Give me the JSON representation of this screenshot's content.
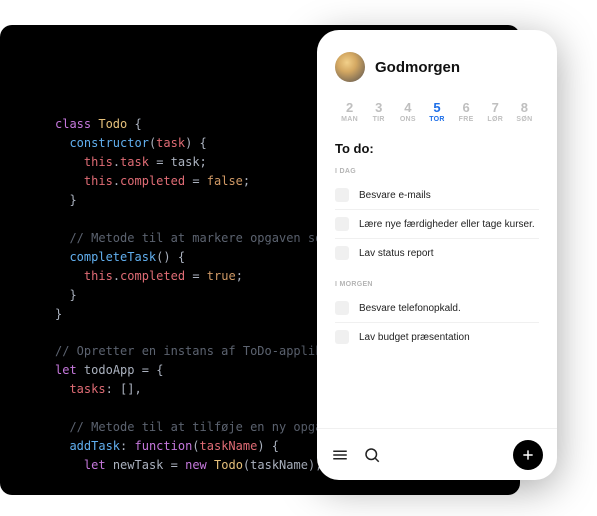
{
  "code": {
    "lines": [
      [
        [
          "kw",
          "class"
        ],
        [
          "plain",
          " "
        ],
        [
          "cls",
          "Todo"
        ],
        [
          "plain",
          " "
        ],
        [
          "punc",
          "{"
        ]
      ],
      [
        [
          "plain",
          "  "
        ],
        [
          "fn",
          "constructor"
        ],
        [
          "punc",
          "("
        ],
        [
          "param",
          "task"
        ],
        [
          "punc",
          ") {"
        ]
      ],
      [
        [
          "plain",
          "    "
        ],
        [
          "this",
          "this"
        ],
        [
          "punc",
          "."
        ],
        [
          "prop",
          "task"
        ],
        [
          "plain",
          " "
        ],
        [
          "punc",
          "="
        ],
        [
          "plain",
          " task"
        ],
        [
          "punc",
          ";"
        ]
      ],
      [
        [
          "plain",
          "    "
        ],
        [
          "this",
          "this"
        ],
        [
          "punc",
          "."
        ],
        [
          "prop",
          "completed"
        ],
        [
          "plain",
          " "
        ],
        [
          "punc",
          "="
        ],
        [
          "plain",
          " "
        ],
        [
          "bool",
          "false"
        ],
        [
          "punc",
          ";"
        ]
      ],
      [
        [
          "plain",
          "  "
        ],
        [
          "punc",
          "}"
        ]
      ],
      [
        [
          "plain",
          ""
        ]
      ],
      [
        [
          "plain",
          "  "
        ],
        [
          "cmt",
          "// Metode til at markere opgaven som"
        ]
      ],
      [
        [
          "plain",
          "  "
        ],
        [
          "fn",
          "completeTask"
        ],
        [
          "punc",
          "() {"
        ]
      ],
      [
        [
          "plain",
          "    "
        ],
        [
          "this",
          "this"
        ],
        [
          "punc",
          "."
        ],
        [
          "prop",
          "completed"
        ],
        [
          "plain",
          " "
        ],
        [
          "punc",
          "="
        ],
        [
          "plain",
          " "
        ],
        [
          "bool",
          "true"
        ],
        [
          "punc",
          ";"
        ]
      ],
      [
        [
          "plain",
          "  "
        ],
        [
          "punc",
          "}"
        ]
      ],
      [
        [
          "punc",
          "}"
        ]
      ],
      [
        [
          "plain",
          ""
        ]
      ],
      [
        [
          "cmt",
          "// Opretter en instans af ToDo-applika"
        ]
      ],
      [
        [
          "kw",
          "let"
        ],
        [
          "plain",
          " "
        ],
        [
          "plain",
          "todoApp"
        ],
        [
          "plain",
          " "
        ],
        [
          "punc",
          "="
        ],
        [
          "plain",
          " "
        ],
        [
          "punc",
          "{"
        ]
      ],
      [
        [
          "plain",
          "  "
        ],
        [
          "prop",
          "tasks"
        ],
        [
          "punc",
          ":"
        ],
        [
          "plain",
          " "
        ],
        [
          "punc",
          "[],"
        ]
      ],
      [
        [
          "plain",
          ""
        ]
      ],
      [
        [
          "plain",
          "  "
        ],
        [
          "cmt",
          "// Metode til at tilføje en ny opgav"
        ]
      ],
      [
        [
          "plain",
          "  "
        ],
        [
          "fn",
          "addTask"
        ],
        [
          "punc",
          ":"
        ],
        [
          "plain",
          " "
        ],
        [
          "kw",
          "function"
        ],
        [
          "punc",
          "("
        ],
        [
          "param",
          "taskName"
        ],
        [
          "punc",
          ") {"
        ]
      ],
      [
        [
          "plain",
          "    "
        ],
        [
          "kw",
          "let"
        ],
        [
          "plain",
          " newTask "
        ],
        [
          "punc",
          "="
        ],
        [
          "plain",
          " "
        ],
        [
          "kw",
          "new"
        ],
        [
          "plain",
          " "
        ],
        [
          "cls",
          "Todo"
        ],
        [
          "punc",
          "("
        ],
        [
          "plain",
          "taskName"
        ],
        [
          "punc",
          ");"
        ]
      ]
    ]
  },
  "app": {
    "greeting": "Godmorgen",
    "week": [
      {
        "num": "2",
        "lbl": "MAN",
        "active": false
      },
      {
        "num": "3",
        "lbl": "TIR",
        "active": false
      },
      {
        "num": "4",
        "lbl": "ONS",
        "active": false
      },
      {
        "num": "5",
        "lbl": "TOR",
        "active": true
      },
      {
        "num": "6",
        "lbl": "FRE",
        "active": false
      },
      {
        "num": "7",
        "lbl": "LØR",
        "active": false
      },
      {
        "num": "8",
        "lbl": "SØN",
        "active": false
      }
    ],
    "todo_title": "To do:",
    "sections": [
      {
        "label": "I DAG",
        "tasks": [
          "Besvare e-mails",
          "Lære nye færdigheder eller tage kurser.",
          "Lav status report"
        ]
      },
      {
        "label": "I MORGEN",
        "tasks": [
          "Besvare telefonopkald.",
          "Lav budget præsentation"
        ]
      }
    ],
    "icons": {
      "menu": "menu-icon",
      "search": "search-icon",
      "add": "plus-icon"
    }
  }
}
